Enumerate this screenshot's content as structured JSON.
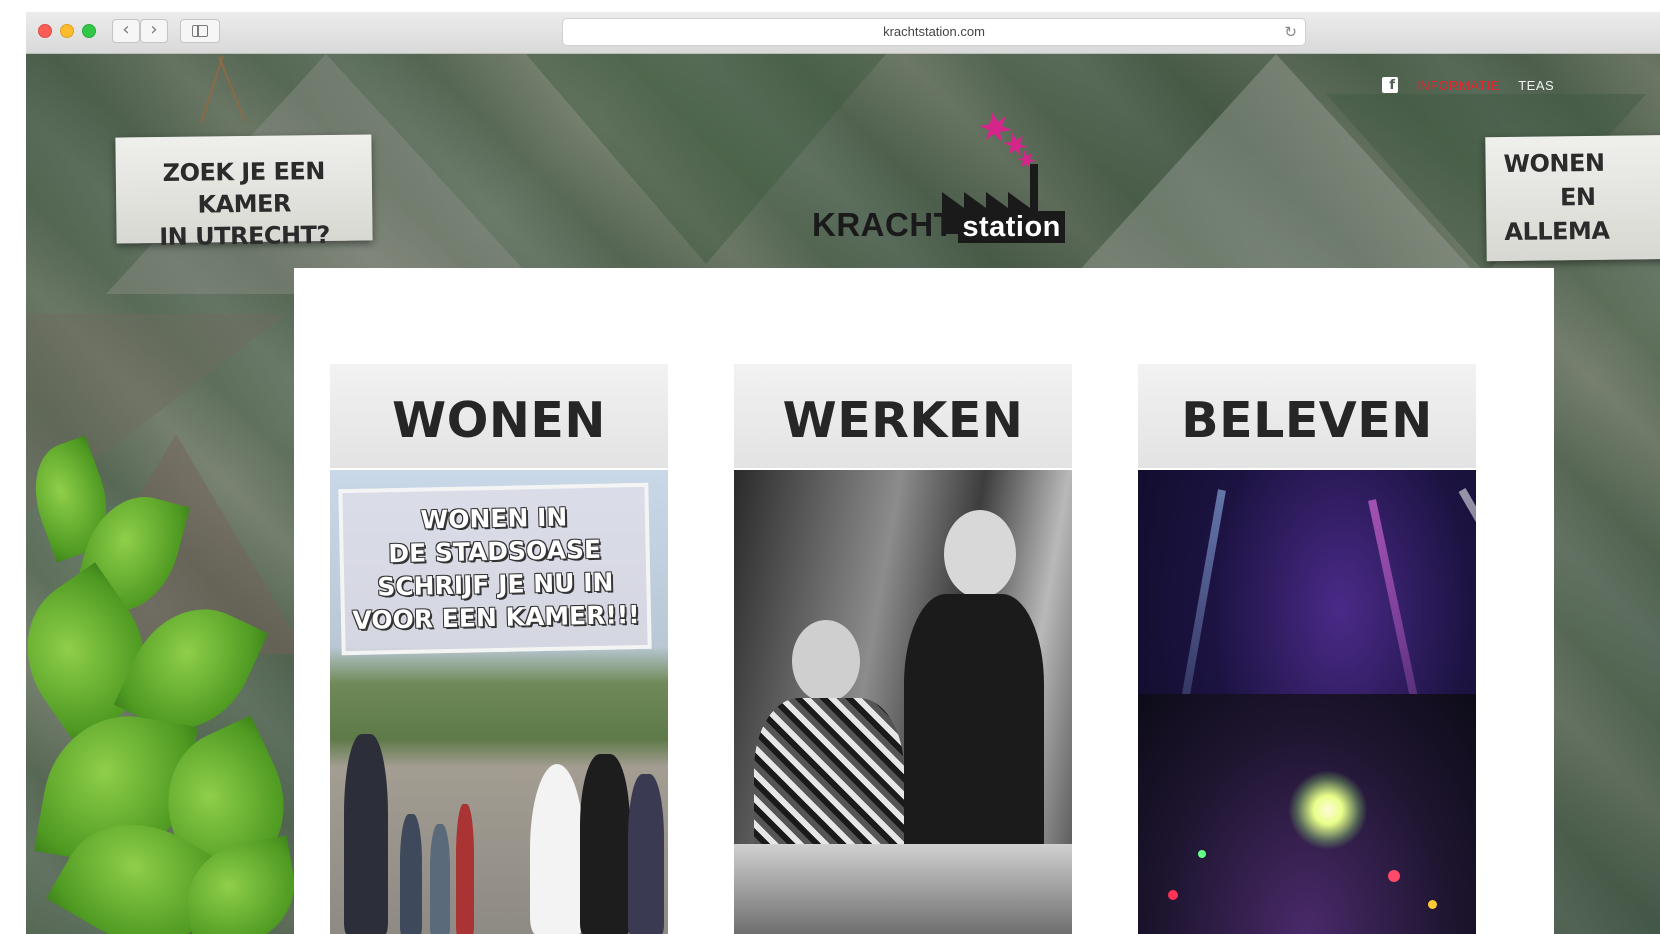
{
  "browser": {
    "url": "krachtstation.com",
    "back_glyph": "‹",
    "forward_glyph": "›",
    "reload_glyph": "↻"
  },
  "site": {
    "nav": {
      "facebook_icon": "facebook-icon",
      "facebook_glyph": "f",
      "links": [
        "INFORMATIE",
        "TEAS"
      ]
    },
    "logo": {
      "word1": "KRACHT",
      "word2": "station"
    },
    "signs": {
      "left": [
        "ZOEK JE EEN KAMER",
        "IN UTRECHT?"
      ],
      "right": [
        "WONEN",
        "EN",
        "ALLEMA"
      ]
    },
    "cards": [
      {
        "title": "WONEN",
        "image_text": [
          "WONEN IN",
          "DE STADSOASE",
          "SCHRIJF JE NU IN",
          "VOOR EEN KAMER!!!"
        ]
      },
      {
        "title": "WERKEN"
      },
      {
        "title": "BELEVEN"
      }
    ]
  }
}
